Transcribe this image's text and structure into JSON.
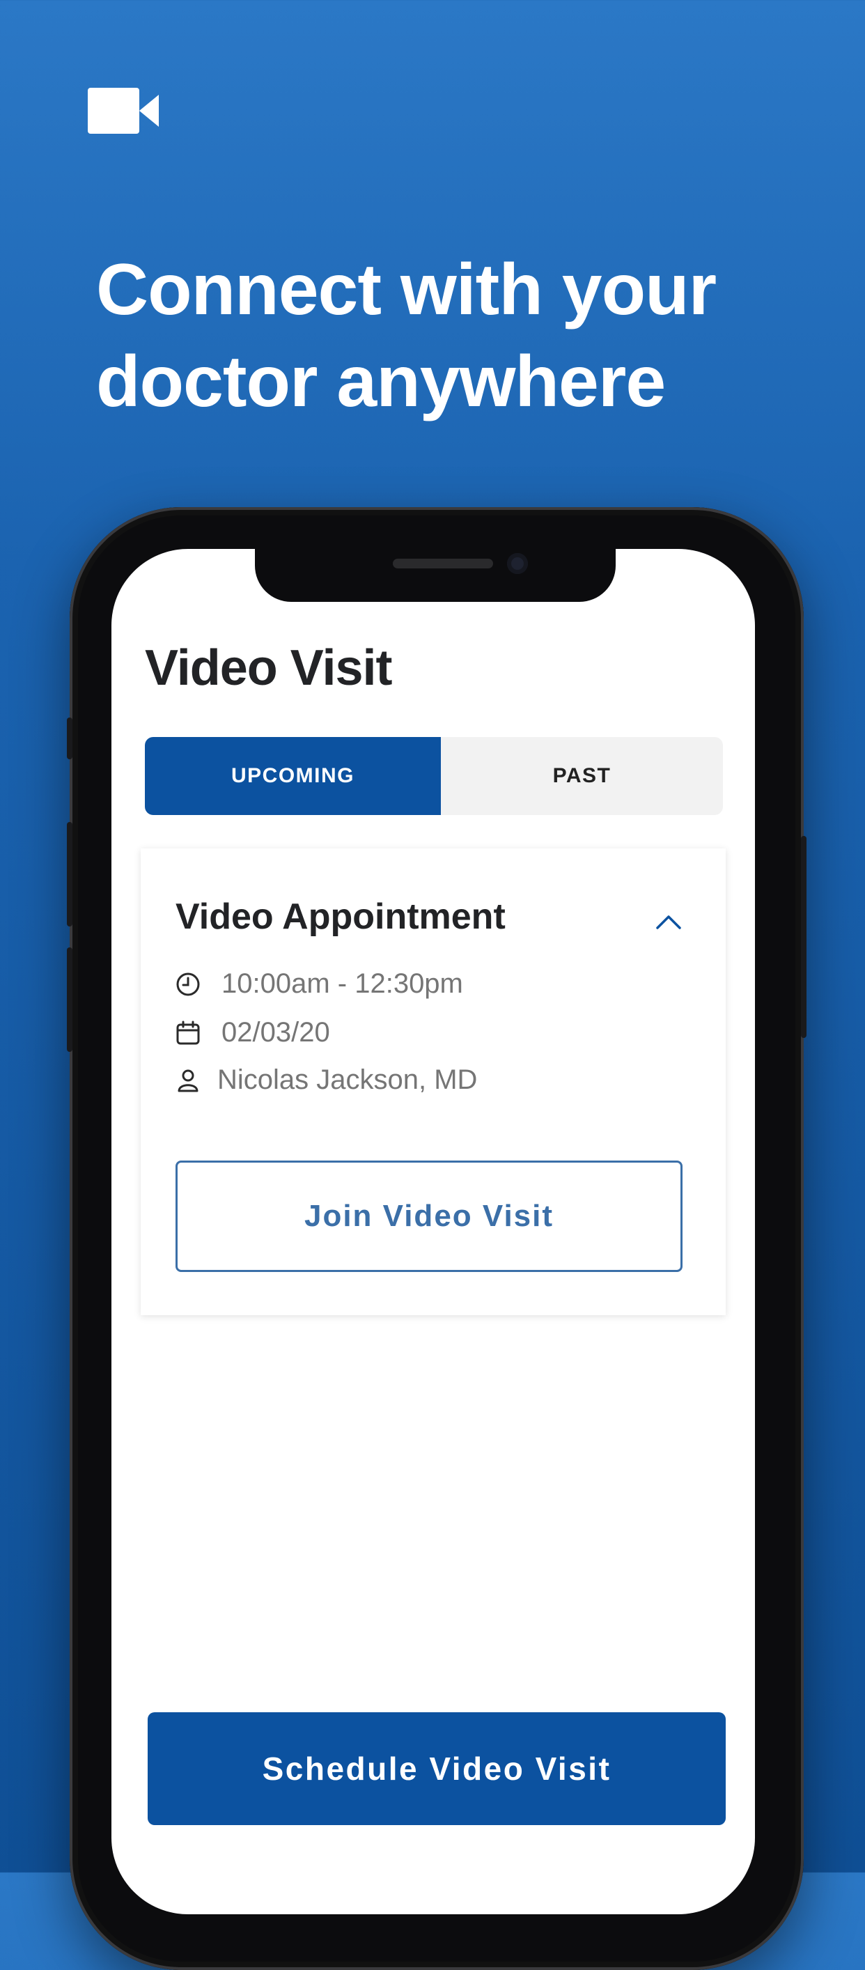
{
  "promo": {
    "headline_line1": "Connect with your",
    "headline_line2": "doctor anywhere",
    "logo_icon": "video-camera-icon"
  },
  "screen": {
    "title": "Video Visit",
    "tabs": [
      {
        "label": "UPCOMING",
        "active": true
      },
      {
        "label": "PAST",
        "active": false
      }
    ],
    "appointment": {
      "title": "Video Appointment",
      "time": "10:00am - 12:30pm",
      "date": "02/03/20",
      "doctor": "Nicolas Jackson, MD",
      "join_label": "Join Video Visit"
    },
    "schedule_label": "Schedule Video Visit"
  },
  "colors": {
    "brand_blue": "#0c52a0",
    "accent_outline": "#3b6fa8",
    "background_gradient": [
      "#2b78c6",
      "#0f4f95"
    ]
  }
}
